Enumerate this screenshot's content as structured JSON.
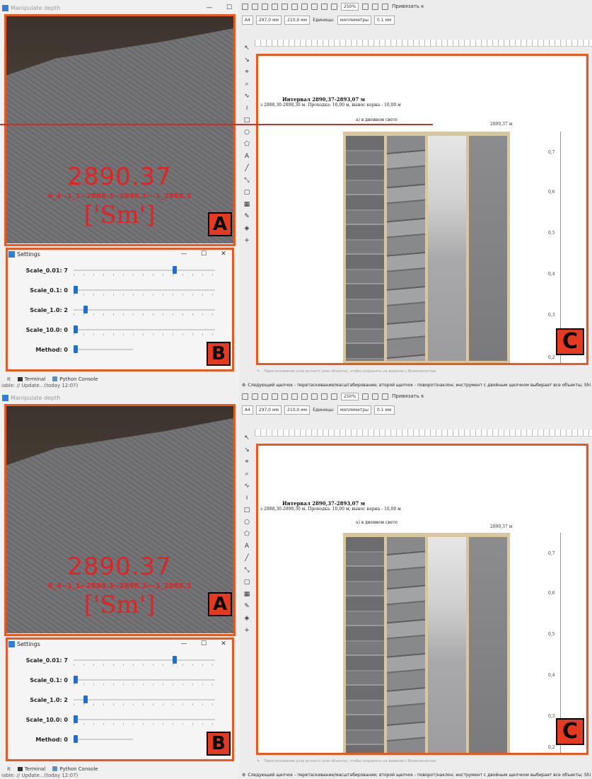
{
  "image_window": {
    "title_top": "Manipulate depth",
    "title_bottom": "Manipulate depth",
    "depth": "2890.37",
    "sample_id": "6_4--1_1--2888.3--2898.3---1_2888.3",
    "lithology": "['Sm']",
    "badge": "A"
  },
  "settings": {
    "title": "Settings",
    "badge": "B",
    "sliders": [
      {
        "label": "Scale_0.01: 7",
        "fraction": 0.72
      },
      {
        "label": "Scale_0.1: 0",
        "fraction": 0.0
      },
      {
        "label": "Scale_1.0: 2",
        "fraction": 0.07
      },
      {
        "label": "Scale_10.0: 0",
        "fraction": 0.0
      },
      {
        "label": "Method: 0",
        "fraction": 0.0
      }
    ]
  },
  "dock": {
    "left_fragment": "it",
    "terminal": "Terminal",
    "python": "Python Console",
    "status": "iable: // Update...(today 12:07)"
  },
  "editor": {
    "zoom": "250%",
    "page_size": "A4",
    "width_field": "297,0 мм",
    "height_field": "210,0 мм",
    "units_label": "Единицы:",
    "units_value": "миллиметры",
    "nudge": "0.1 мм",
    "snap_label": "Привязать к",
    "document": {
      "title": "Интервал 2890,37-2893,07 м",
      "line": "з 2888,30-2898,30 м. Проходка- 10,00 м, вынос керна - 10,00 м",
      "sub": "а) в дневном свете",
      "depth_tag": "2890,37 м",
      "scale_labels": [
        "0,7",
        "0,6",
        "0,5",
        "0,4",
        "0,3",
        "0,2"
      ]
    },
    "badge": "C",
    "status": "Перетаскивание узла ручного (или объекта), чтобы сохранить на вывеске с Возможностью",
    "hint": "Следующий щелчок - перетаскивание/масштабирование; второй щелчок - поворот/наклон; инструмент с двойным щелчком выбирает все объекты; Shi"
  }
}
